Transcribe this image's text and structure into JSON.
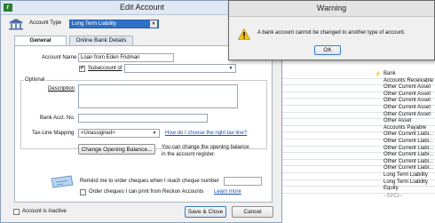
{
  "edit_dialog": {
    "title": "Edit Account",
    "minimize_glyph": "—",
    "account_type_label": "Account Type",
    "account_type_value": "Long Term Liability",
    "tabs": [
      {
        "label": "General"
      },
      {
        "label": "Online Bank Details"
      }
    ],
    "account_name_label": "Account Name",
    "account_name_value": "Loan from Eden Fridman",
    "subaccount_label": "Subaccount of",
    "subaccount_checked": true,
    "optional_label": "Optional",
    "description_label": "Description",
    "bank_acct_label": "Bank Acct. No.",
    "tax_line_label": "Tax-Line Mapping",
    "tax_line_value": "<Unassigned>",
    "tax_line_link": "How do I choose the right tax line?",
    "opening_balance_button": "Change Opening Balance...",
    "opening_balance_text": "You can change the opening balance in the account register.",
    "remind_label": "Remind me to order cheques when I reach cheque number",
    "order_cheques_label": "Order cheques I can print from Reckon Accounts",
    "learn_more": "Learn more",
    "inactive_label": "Account is inactive",
    "save_close": "Save & Close",
    "cancel": "Cancel"
  },
  "warning": {
    "title": "Warning",
    "message": "A bank account cannot be changed to another type of account.",
    "ok": "OK",
    "icon": "warning-icon"
  },
  "account_list": {
    "types": [
      "Bank",
      "Accounts Receivable",
      "Other Current Asset",
      "Other Current Asset",
      "Other Current Asset",
      "Other Current Asset",
      "Other Current Asset",
      "Other Asset",
      "Accounts Payable",
      "Other Current Liabi...",
      "Other Current Liabi...",
      "Other Current Liabi...",
      "Other Current Liabi...",
      "Other Current Liabi...",
      "Other Current Liabi...",
      "Long Term Liability",
      "Long Term Liability",
      "Equity"
    ],
    "more_indicator": "~SPCI~"
  }
}
